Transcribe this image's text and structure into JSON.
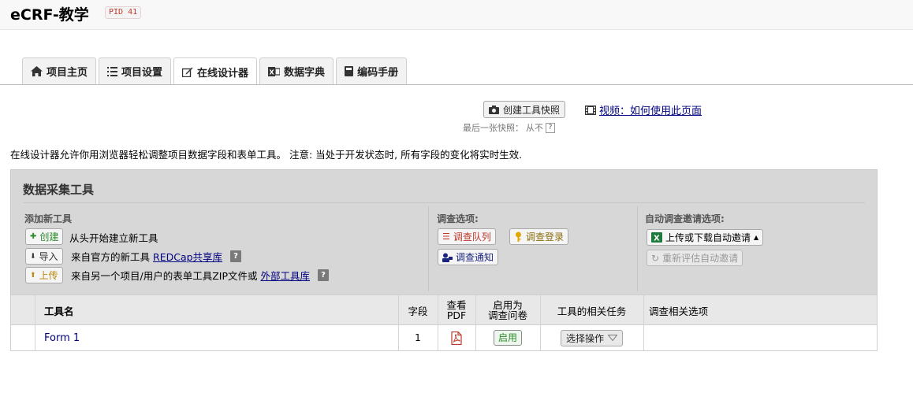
{
  "project": {
    "title": "eCRF-教学",
    "pid": "PID 41"
  },
  "tabs": [
    {
      "label": "项目主页",
      "icon": "home-icon"
    },
    {
      "label": "项目设置",
      "icon": "list-icon"
    },
    {
      "label": "在线设计器",
      "icon": "edit-icon",
      "active": true
    },
    {
      "label": "数据字典",
      "icon": "excel-icon"
    },
    {
      "label": "编码手册",
      "icon": "book-icon"
    }
  ],
  "snapshot": {
    "button_label": "创建工具快照",
    "video_label": "视频：如何使用此页面",
    "last_label": "最后一张快照：",
    "last_value": "从不",
    "help": "?"
  },
  "description": "在线设计器允许你用浏览器轻松调整项目数据字段和表单工具。 注意: 当处于开发状态时, 所有字段的变化将实时生效.",
  "panel": {
    "title": "数据采集工具",
    "add_head": "添加新工具",
    "create_btn": "创建",
    "create_text": "从头开始建立新工具",
    "import_btn": "导入",
    "import_text": "来自官方的新工具",
    "import_link": "REDCap共享库",
    "upload_btn": "上传",
    "upload_text": "来自另一个项目/用户的表单工具ZIP文件或",
    "upload_link": "外部工具库",
    "help": "?",
    "survey_head": "调查选项:",
    "survey_queue": "调查队列",
    "survey_login": "调查登录",
    "survey_notify": "调查通知",
    "auto_head": "自动调查邀请选项:",
    "auto_updown": "上传或下载自动邀请",
    "auto_reeval": "重新评估自动邀请"
  },
  "table": {
    "headers": {
      "name": "工具名",
      "fields": "字段",
      "pdf_1": "查看",
      "pdf_2": "PDF",
      "enable_1": "启用为",
      "enable_2": "调查问卷",
      "tasks": "工具的相关任务",
      "survey_opts": "调查相关选项"
    },
    "rows": [
      {
        "name": "Form 1",
        "fields": "1",
        "enable": "启用",
        "action": "选择操作"
      }
    ]
  },
  "colors": {
    "link": "#000080",
    "green": "#2e8b2e",
    "red": "#c0392b",
    "panel_bg": "#d7d7d7"
  }
}
